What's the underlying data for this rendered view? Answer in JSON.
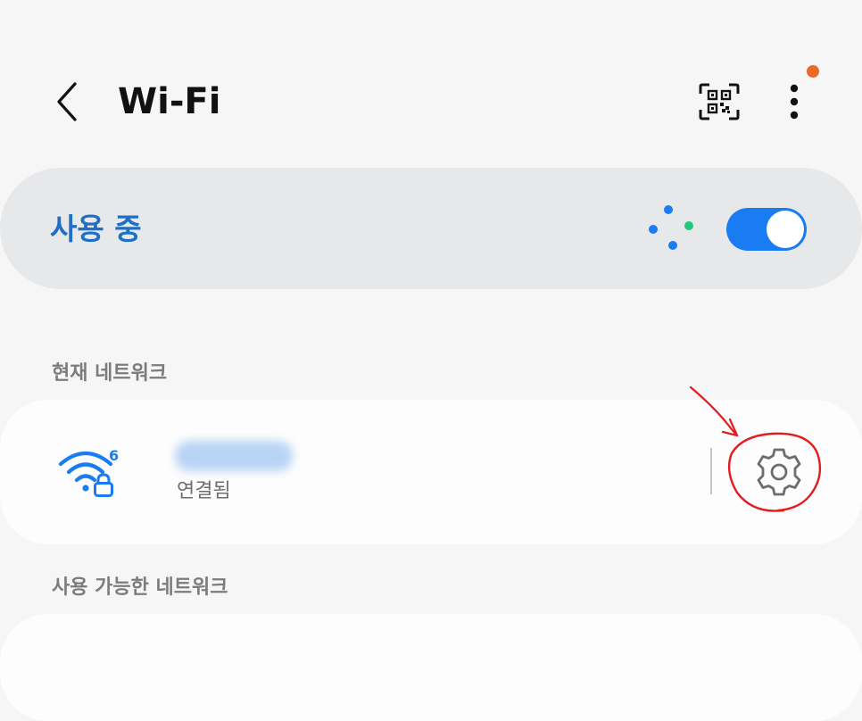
{
  "header": {
    "title": "Wi-Fi",
    "back_icon": "chevron-left-icon",
    "qr_icon": "qr-scan-icon",
    "more_icon": "more-vertical-icon",
    "notification_color": "#ea6a2a"
  },
  "toggle": {
    "label": "사용 중",
    "state": true,
    "accent": "#1a7cf2",
    "scan_icon": "scanning-dots-icon"
  },
  "current_network": {
    "section_label": "현재 네트워크",
    "status": "연결됨",
    "wifi_icon": "wifi-6-lock-icon",
    "settings_icon": "gear-icon"
  },
  "available_networks": {
    "section_label": "사용 가능한 네트워크"
  }
}
